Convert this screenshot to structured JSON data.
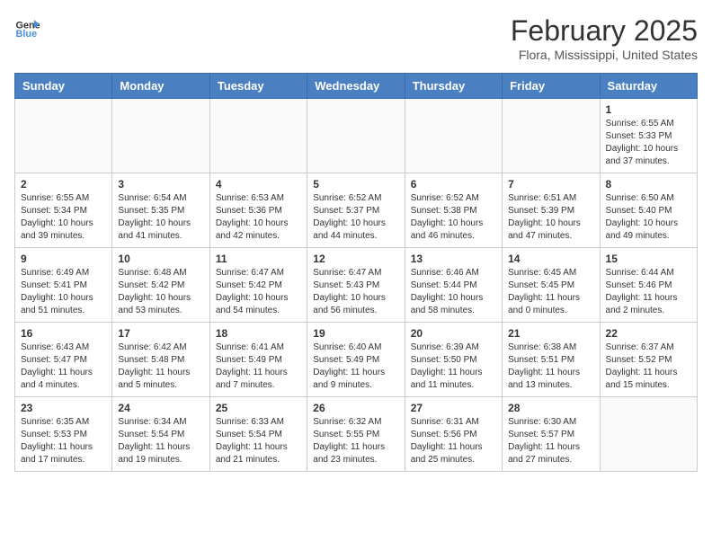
{
  "header": {
    "logo_line1": "General",
    "logo_line2": "Blue",
    "title": "February 2025",
    "subtitle": "Flora, Mississippi, United States"
  },
  "weekdays": [
    "Sunday",
    "Monday",
    "Tuesday",
    "Wednesday",
    "Thursday",
    "Friday",
    "Saturday"
  ],
  "weeks": [
    [
      {
        "day": "",
        "empty": true
      },
      {
        "day": "",
        "empty": true
      },
      {
        "day": "",
        "empty": true
      },
      {
        "day": "",
        "empty": true
      },
      {
        "day": "",
        "empty": true
      },
      {
        "day": "",
        "empty": true
      },
      {
        "day": "1",
        "rise": "6:55 AM",
        "set": "5:33 PM",
        "daylight": "10 hours and 37 minutes."
      }
    ],
    [
      {
        "day": "2",
        "rise": "6:55 AM",
        "set": "5:34 PM",
        "daylight": "10 hours and 39 minutes."
      },
      {
        "day": "3",
        "rise": "6:54 AM",
        "set": "5:35 PM",
        "daylight": "10 hours and 41 minutes."
      },
      {
        "day": "4",
        "rise": "6:53 AM",
        "set": "5:36 PM",
        "daylight": "10 hours and 42 minutes."
      },
      {
        "day": "5",
        "rise": "6:52 AM",
        "set": "5:37 PM",
        "daylight": "10 hours and 44 minutes."
      },
      {
        "day": "6",
        "rise": "6:52 AM",
        "set": "5:38 PM",
        "daylight": "10 hours and 46 minutes."
      },
      {
        "day": "7",
        "rise": "6:51 AM",
        "set": "5:39 PM",
        "daylight": "10 hours and 47 minutes."
      },
      {
        "day": "8",
        "rise": "6:50 AM",
        "set": "5:40 PM",
        "daylight": "10 hours and 49 minutes."
      }
    ],
    [
      {
        "day": "9",
        "rise": "6:49 AM",
        "set": "5:41 PM",
        "daylight": "10 hours and 51 minutes."
      },
      {
        "day": "10",
        "rise": "6:48 AM",
        "set": "5:42 PM",
        "daylight": "10 hours and 53 minutes."
      },
      {
        "day": "11",
        "rise": "6:47 AM",
        "set": "5:42 PM",
        "daylight": "10 hours and 54 minutes."
      },
      {
        "day": "12",
        "rise": "6:47 AM",
        "set": "5:43 PM",
        "daylight": "10 hours and 56 minutes."
      },
      {
        "day": "13",
        "rise": "6:46 AM",
        "set": "5:44 PM",
        "daylight": "10 hours and 58 minutes."
      },
      {
        "day": "14",
        "rise": "6:45 AM",
        "set": "5:45 PM",
        "daylight": "11 hours and 0 minutes."
      },
      {
        "day": "15",
        "rise": "6:44 AM",
        "set": "5:46 PM",
        "daylight": "11 hours and 2 minutes."
      }
    ],
    [
      {
        "day": "16",
        "rise": "6:43 AM",
        "set": "5:47 PM",
        "daylight": "11 hours and 4 minutes."
      },
      {
        "day": "17",
        "rise": "6:42 AM",
        "set": "5:48 PM",
        "daylight": "11 hours and 5 minutes."
      },
      {
        "day": "18",
        "rise": "6:41 AM",
        "set": "5:49 PM",
        "daylight": "11 hours and 7 minutes."
      },
      {
        "day": "19",
        "rise": "6:40 AM",
        "set": "5:49 PM",
        "daylight": "11 hours and 9 minutes."
      },
      {
        "day": "20",
        "rise": "6:39 AM",
        "set": "5:50 PM",
        "daylight": "11 hours and 11 minutes."
      },
      {
        "day": "21",
        "rise": "6:38 AM",
        "set": "5:51 PM",
        "daylight": "11 hours and 13 minutes."
      },
      {
        "day": "22",
        "rise": "6:37 AM",
        "set": "5:52 PM",
        "daylight": "11 hours and 15 minutes."
      }
    ],
    [
      {
        "day": "23",
        "rise": "6:35 AM",
        "set": "5:53 PM",
        "daylight": "11 hours and 17 minutes."
      },
      {
        "day": "24",
        "rise": "6:34 AM",
        "set": "5:54 PM",
        "daylight": "11 hours and 19 minutes."
      },
      {
        "day": "25",
        "rise": "6:33 AM",
        "set": "5:54 PM",
        "daylight": "11 hours and 21 minutes."
      },
      {
        "day": "26",
        "rise": "6:32 AM",
        "set": "5:55 PM",
        "daylight": "11 hours and 23 minutes."
      },
      {
        "day": "27",
        "rise": "6:31 AM",
        "set": "5:56 PM",
        "daylight": "11 hours and 25 minutes."
      },
      {
        "day": "28",
        "rise": "6:30 AM",
        "set": "5:57 PM",
        "daylight": "11 hours and 27 minutes."
      },
      {
        "day": "",
        "empty": true
      }
    ]
  ]
}
